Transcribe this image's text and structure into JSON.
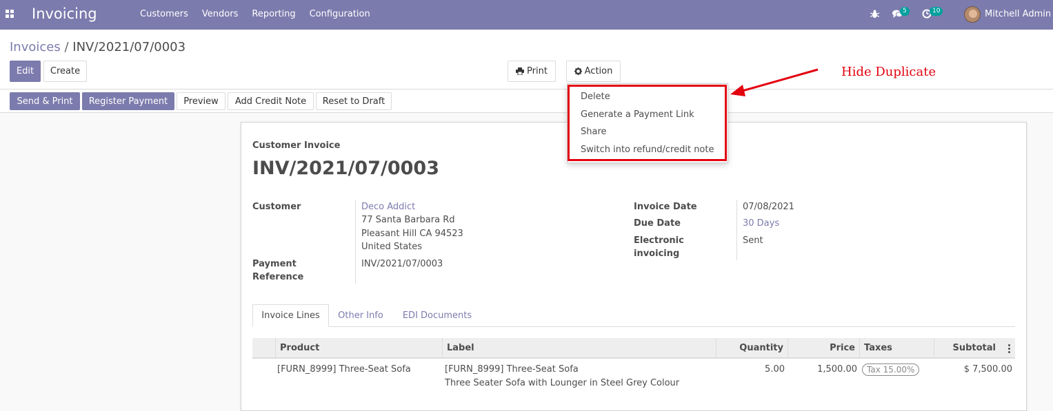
{
  "navbar": {
    "app_name": "Invoicing",
    "menu": [
      "Customers",
      "Vendors",
      "Reporting",
      "Configuration"
    ],
    "messages_count": "5",
    "activities_count": "10",
    "user_name": "Mitchell Admin"
  },
  "breadcrumb": {
    "parent": "Invoices",
    "separator": "/",
    "current": "INV/2021/07/0003"
  },
  "buttons": {
    "edit": "Edit",
    "create": "Create",
    "print": "Print",
    "action": "Action"
  },
  "status_buttons": {
    "send_print": "Send & Print",
    "register_payment": "Register Payment",
    "preview": "Preview",
    "add_credit_note": "Add Credit Note",
    "reset_to_draft": "Reset to Draft"
  },
  "action_menu": {
    "items": [
      "Delete",
      "Generate a Payment Link",
      "Share",
      "Switch into refund/credit note"
    ]
  },
  "annotation": {
    "text": "Hide Duplicate",
    "color": "#e3000f"
  },
  "form": {
    "doc_type": "Customer Invoice",
    "doc_name": "INV/2021/07/0003",
    "customer_label": "Customer",
    "customer_name": "Deco Addict",
    "address_line1": "77 Santa Barbara Rd",
    "address_line2": "Pleasant Hill CA 94523",
    "address_line3": "United States",
    "payment_ref_label_1": "Payment",
    "payment_ref_label_2": "Reference",
    "payment_ref_value": "INV/2021/07/0003",
    "invoice_date_label": "Invoice Date",
    "invoice_date_value": "07/08/2021",
    "due_date_label": "Due Date",
    "due_date_value": "30 Days",
    "einvoicing_label_1": "Electronic",
    "einvoicing_label_2": "invoicing",
    "einvoicing_value": "Sent"
  },
  "tabs": [
    "Invoice Lines",
    "Other Info",
    "EDI Documents"
  ],
  "table": {
    "headers": {
      "product": "Product",
      "label": "Label",
      "quantity": "Quantity",
      "price": "Price",
      "taxes": "Taxes",
      "subtotal": "Subtotal"
    },
    "rows": [
      {
        "product": "[FURN_8999] Three-Seat Sofa",
        "label_line1": "[FURN_8999] Three-Seat Sofa",
        "label_line2": "Three Seater Sofa with Lounger in Steel Grey Colour",
        "quantity": "5.00",
        "price": "1,500.00",
        "tax": "Tax 15.00%",
        "subtotal": "$ 7,500.00"
      }
    ]
  },
  "colors": {
    "brand": "#7c7bad",
    "badge": "#00a09d",
    "highlight": "#e3000f"
  }
}
